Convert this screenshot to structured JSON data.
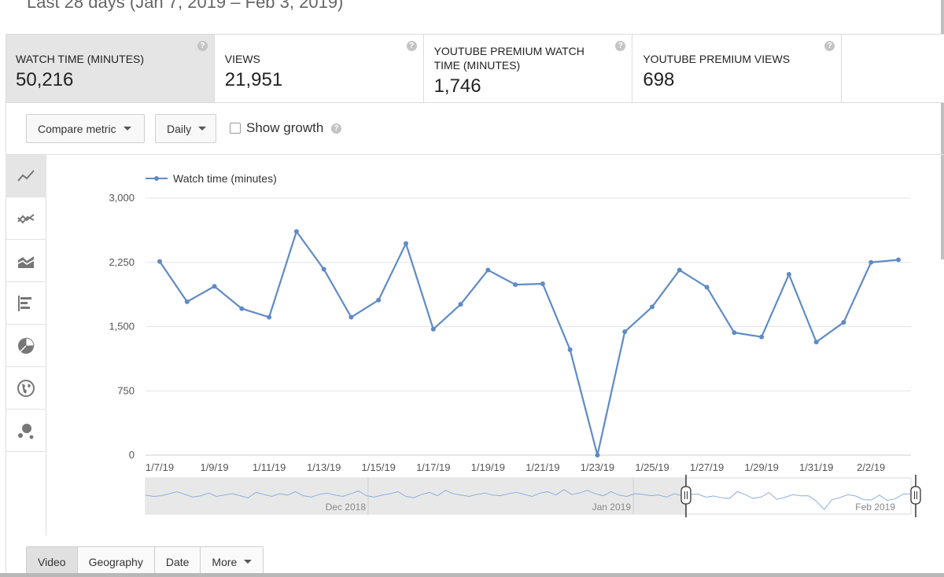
{
  "header": {
    "date_range": "Last 28 days (Jan 7, 2019 – Feb 3, 2019)"
  },
  "metrics": [
    {
      "label": "WATCH TIME (MINUTES)",
      "value": "50,216"
    },
    {
      "label": "VIEWS",
      "value": "21,951"
    },
    {
      "label": "YOUTUBE PREMIUM WATCH TIME (MINUTES)",
      "value": "1,746"
    },
    {
      "label": "YOUTUBE PREMIUM VIEWS",
      "value": "698"
    }
  ],
  "help_glyph": "?",
  "toolbar": {
    "compare_label": "Compare metric",
    "interval_label": "Daily",
    "show_growth_label": "Show growth",
    "show_growth_checked": false
  },
  "chart_types": [
    {
      "name": "line-chart-icon",
      "active": true
    },
    {
      "name": "multi-line-chart-icon",
      "active": false
    },
    {
      "name": "stacked-area-chart-icon",
      "active": false
    },
    {
      "name": "bar-chart-icon",
      "active": false
    },
    {
      "name": "pie-chart-icon",
      "active": false
    },
    {
      "name": "globe-icon",
      "active": false
    },
    {
      "name": "bubble-chart-icon",
      "active": false
    }
  ],
  "tabs": [
    {
      "label": "Video",
      "active": true
    },
    {
      "label": "Geography",
      "active": false
    },
    {
      "label": "Date",
      "active": false
    },
    {
      "label": "More",
      "dropdown": true,
      "active": false
    }
  ],
  "colors": {
    "series": "#5f8bc5",
    "grid": "#e5e5e5",
    "active_bg": "#e5e5e5"
  },
  "chart_data": {
    "type": "line",
    "legend": {
      "entries": [
        "Watch time (minutes)"
      ],
      "placement": "top-left"
    },
    "ylim": [
      0,
      3000
    ],
    "yticks": [
      0,
      750,
      1500,
      2250,
      3000
    ],
    "ytick_labels": [
      "0",
      "750",
      "1,500",
      "2,250",
      "3,000"
    ],
    "x": [
      "1/7/19",
      "1/8/19",
      "1/9/19",
      "1/10/19",
      "1/11/19",
      "1/12/19",
      "1/13/19",
      "1/14/19",
      "1/15/19",
      "1/16/19",
      "1/17/19",
      "1/18/19",
      "1/19/19",
      "1/20/19",
      "1/21/19",
      "1/22/19",
      "1/23/19",
      "1/24/19",
      "1/25/19",
      "1/26/19",
      "1/27/19",
      "1/28/19",
      "1/29/19",
      "1/30/19",
      "1/31/19",
      "2/1/19",
      "2/2/19",
      "2/3/19"
    ],
    "xtick_labels": [
      "1/7/19",
      "1/9/19",
      "1/11/19",
      "1/13/19",
      "1/15/19",
      "1/17/19",
      "1/19/19",
      "1/21/19",
      "1/23/19",
      "1/25/19",
      "1/27/19",
      "1/29/19",
      "1/31/19",
      "2/2/19"
    ],
    "series": [
      {
        "name": "Watch time (minutes)",
        "values": [
          2260,
          1790,
          1970,
          1710,
          1610,
          2610,
          2170,
          1610,
          1810,
          2470,
          1470,
          1760,
          2160,
          1990,
          2000,
          1230,
          0,
          1440,
          1730,
          2160,
          1960,
          1430,
          1380,
          2110,
          1320,
          1550,
          2250,
          2280
        ]
      }
    ],
    "grid": true,
    "navigator": {
      "labels": [
        "Dec 2018",
        "Jan 2019",
        "Feb 2019"
      ],
      "values": [
        2100,
        1900,
        2000,
        2300,
        2600,
        2200,
        1800,
        2000,
        2400,
        1900,
        2100,
        2300,
        2000,
        1700,
        2500,
        2200,
        1900,
        2300,
        2100,
        2600,
        2000,
        1800,
        2200,
        2400,
        2100,
        1900,
        2300,
        2700,
        2000,
        1800,
        2100,
        2300,
        2600,
        1900,
        1700,
        2200,
        2500,
        2000,
        2800,
        2300,
        2100,
        1900,
        2200,
        2400,
        2100,
        2000,
        2300,
        2500,
        2200,
        1900,
        2400,
        2600,
        2100,
        2900,
        2200,
        2400,
        2800,
        2300,
        2000,
        2600,
        2100,
        1900,
        2300,
        2200,
        2000,
        2100,
        1800,
        2300,
        2000,
        2200,
        2260,
        1790,
        1970,
        1710,
        1610,
        2610,
        2170,
        1610,
        1810,
        2470,
        1470,
        1760,
        2160,
        1990,
        2000,
        1230,
        0,
        1440,
        1730,
        2160,
        1960,
        1430,
        1380,
        2110,
        1320,
        1550,
        2250,
        2280
      ]
    }
  }
}
